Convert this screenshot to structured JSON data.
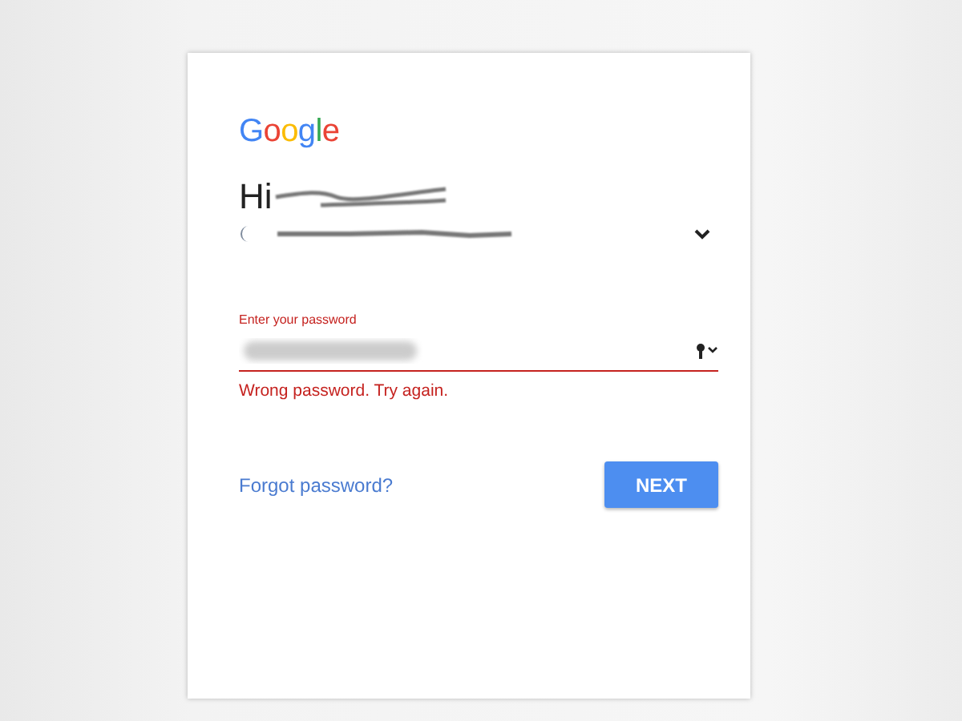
{
  "logo": "Google",
  "greeting": "Hi",
  "password_field": {
    "label": "Enter your password",
    "invalid": true,
    "error": "Wrong password. Try again."
  },
  "forgot_link": "Forgot password?",
  "next_button": "NEXT"
}
